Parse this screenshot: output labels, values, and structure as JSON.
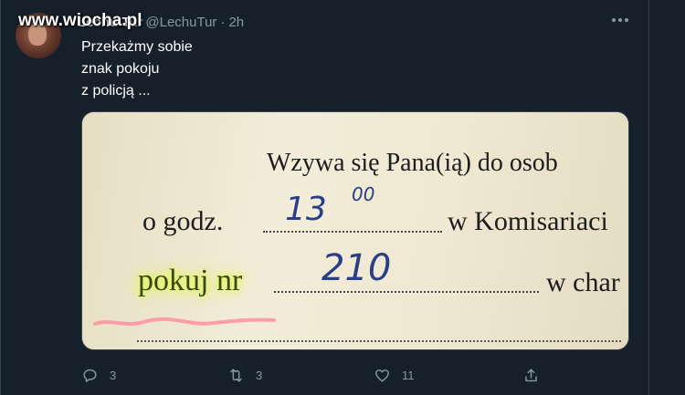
{
  "tweet": {
    "display_name": "Lechu Tur",
    "handle": "@LechuTur",
    "time": "2h",
    "text_lines": [
      "Przekażmy sobie",
      "znak pokoju",
      "z policją ..."
    ]
  },
  "watermark": "www.wiocha.pl",
  "media": {
    "line1": "Wzywa się Pana(ią) do osob",
    "row2_label": "o godz.",
    "row2_handwritten": "13",
    "row2_handwritten_sup": "00",
    "row2_after": "w Komisariaci",
    "row3_label": "pokuj nr",
    "row3_handwritten": "210",
    "row3_after": "w char"
  },
  "actions": {
    "reply_count": "3",
    "retweet_count": "3",
    "like_count": "11"
  },
  "colors": {
    "background": "#15202b",
    "muted": "#8899a6",
    "divider": "#38444d",
    "highlight": "#d9ff3a"
  },
  "icons": [
    "more-icon",
    "reply-icon",
    "retweet-icon",
    "like-icon",
    "share-icon"
  ]
}
